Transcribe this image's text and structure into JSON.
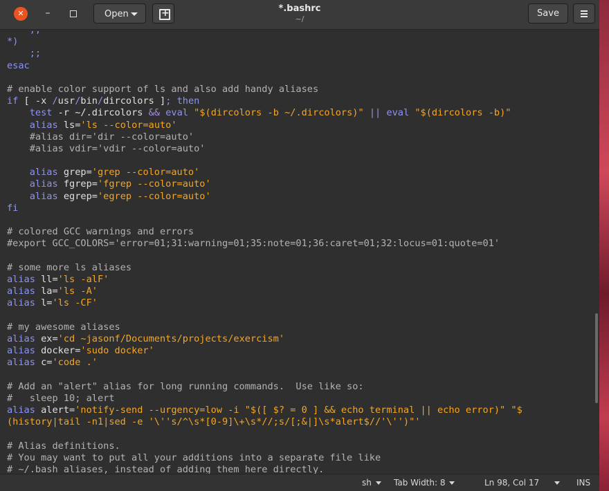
{
  "header": {
    "title": "*.bashrc",
    "subtitle": "~/",
    "open_label": "Open",
    "save_label": "Save"
  },
  "statusbar": {
    "language": "sh",
    "tab_width": "Tab Width: 8",
    "position": "Ln 98, Col 17",
    "mode": "INS"
  },
  "colors": {
    "accent": "#e95420",
    "comment": "#b3b3b3",
    "keyword": "#8e95ee",
    "string": "#f5a623"
  },
  "icons": [
    "close-icon",
    "minimize-icon",
    "maximize-icon",
    "new-document-icon",
    "hamburger-menu-icon"
  ],
  "code_lines": [
    [
      {
        "t": "    ;;",
        "c": "k"
      }
    ],
    [
      {
        "t": "*)",
        "c": "k"
      }
    ],
    [
      {
        "t": "    ;;",
        "c": "k"
      }
    ],
    [
      {
        "t": "esac",
        "c": "k"
      }
    ],
    [],
    [
      {
        "t": "# enable color support of ls and also add handy aliases",
        "c": "c"
      }
    ],
    [
      {
        "t": "if",
        "c": "k"
      },
      {
        "t": " [ -x "
      },
      {
        "t": "/",
        "c": "o"
      },
      {
        "t": "usr"
      },
      {
        "t": "/",
        "c": "o"
      },
      {
        "t": "bin"
      },
      {
        "t": "/",
        "c": "o"
      },
      {
        "t": "dircolors ]"
      },
      {
        "t": "; then",
        "c": "k"
      }
    ],
    [
      {
        "t": "    "
      },
      {
        "t": "test",
        "c": "k"
      },
      {
        "t": " -r ~/.dircolors "
      },
      {
        "t": "&&",
        "c": "o"
      },
      {
        "t": " "
      },
      {
        "t": "eval",
        "c": "k"
      },
      {
        "t": " "
      },
      {
        "t": "\"$(dircolors -b ~/.dircolors)\"",
        "c": "s"
      },
      {
        "t": " "
      },
      {
        "t": "||",
        "c": "o"
      },
      {
        "t": " "
      },
      {
        "t": "eval",
        "c": "k"
      },
      {
        "t": " "
      },
      {
        "t": "\"$(dircolors -b)\"",
        "c": "s"
      }
    ],
    [
      {
        "t": "    "
      },
      {
        "t": "alias",
        "c": "k"
      },
      {
        "t": " ls="
      },
      {
        "t": "'ls --color=auto'",
        "c": "s"
      }
    ],
    [
      {
        "t": "    #alias dir='dir --color=auto'",
        "c": "c"
      }
    ],
    [
      {
        "t": "    #alias vdir='vdir --color=auto'",
        "c": "c"
      }
    ],
    [],
    [
      {
        "t": "    "
      },
      {
        "t": "alias",
        "c": "k"
      },
      {
        "t": " grep="
      },
      {
        "t": "'grep --color=auto'",
        "c": "s"
      }
    ],
    [
      {
        "t": "    "
      },
      {
        "t": "alias",
        "c": "k"
      },
      {
        "t": " fgrep="
      },
      {
        "t": "'fgrep --color=auto'",
        "c": "s"
      }
    ],
    [
      {
        "t": "    "
      },
      {
        "t": "alias",
        "c": "k"
      },
      {
        "t": " egrep="
      },
      {
        "t": "'egrep --color=auto'",
        "c": "s"
      }
    ],
    [
      {
        "t": "fi",
        "c": "k"
      }
    ],
    [],
    [
      {
        "t": "# colored GCC warnings and errors",
        "c": "c"
      }
    ],
    [
      {
        "t": "#export GCC_COLORS='error=01;31:warning=01;35:note=01;36:caret=01;32:locus=01:quote=01'",
        "c": "c"
      }
    ],
    [],
    [
      {
        "t": "# some more ls aliases",
        "c": "c"
      }
    ],
    [
      {
        "t": "alias",
        "c": "k"
      },
      {
        "t": " ll="
      },
      {
        "t": "'ls -alF'",
        "c": "s"
      }
    ],
    [
      {
        "t": "alias",
        "c": "k"
      },
      {
        "t": " la="
      },
      {
        "t": "'ls -A'",
        "c": "s"
      }
    ],
    [
      {
        "t": "alias",
        "c": "k"
      },
      {
        "t": " l="
      },
      {
        "t": "'ls -CF'",
        "c": "s"
      }
    ],
    [],
    [
      {
        "t": "# my awesome aliases",
        "c": "c"
      }
    ],
    [
      {
        "t": "alias",
        "c": "k"
      },
      {
        "t": " ex="
      },
      {
        "t": "'cd ~jasonf/Documents/projects/exercism'",
        "c": "s"
      }
    ],
    [
      {
        "t": "alias",
        "c": "k"
      },
      {
        "t": " docker="
      },
      {
        "t": "'sudo docker'",
        "c": "s"
      }
    ],
    [
      {
        "t": "alias",
        "c": "k"
      },
      {
        "t": " c="
      },
      {
        "t": "'code .'",
        "c": "s"
      }
    ],
    [],
    [
      {
        "t": "# Add an \"alert\" alias for long running commands.  Use like so:",
        "c": "c"
      }
    ],
    [
      {
        "t": "#   sleep 10; alert",
        "c": "c"
      }
    ],
    [
      {
        "t": "alias",
        "c": "k"
      },
      {
        "t": " alert="
      },
      {
        "t": "'notify-send --urgency=low -i \"$([ $? = 0 ] && echo terminal || echo error)\" \"$",
        "c": "s"
      }
    ],
    [
      {
        "t": "(history|tail -n1|sed -e '\\''s/^\\s*[0-9]\\+\\s*//;s/[;&|]\\s*alert$//'\\'')\"'",
        "c": "s"
      }
    ],
    [],
    [
      {
        "t": "# Alias definitions.",
        "c": "c"
      }
    ],
    [
      {
        "t": "# You may want to put all your additions into a separate file like",
        "c": "c"
      }
    ],
    [
      {
        "t": "# ~/.bash_aliases, instead of adding them here directly.",
        "c": "c"
      }
    ]
  ]
}
